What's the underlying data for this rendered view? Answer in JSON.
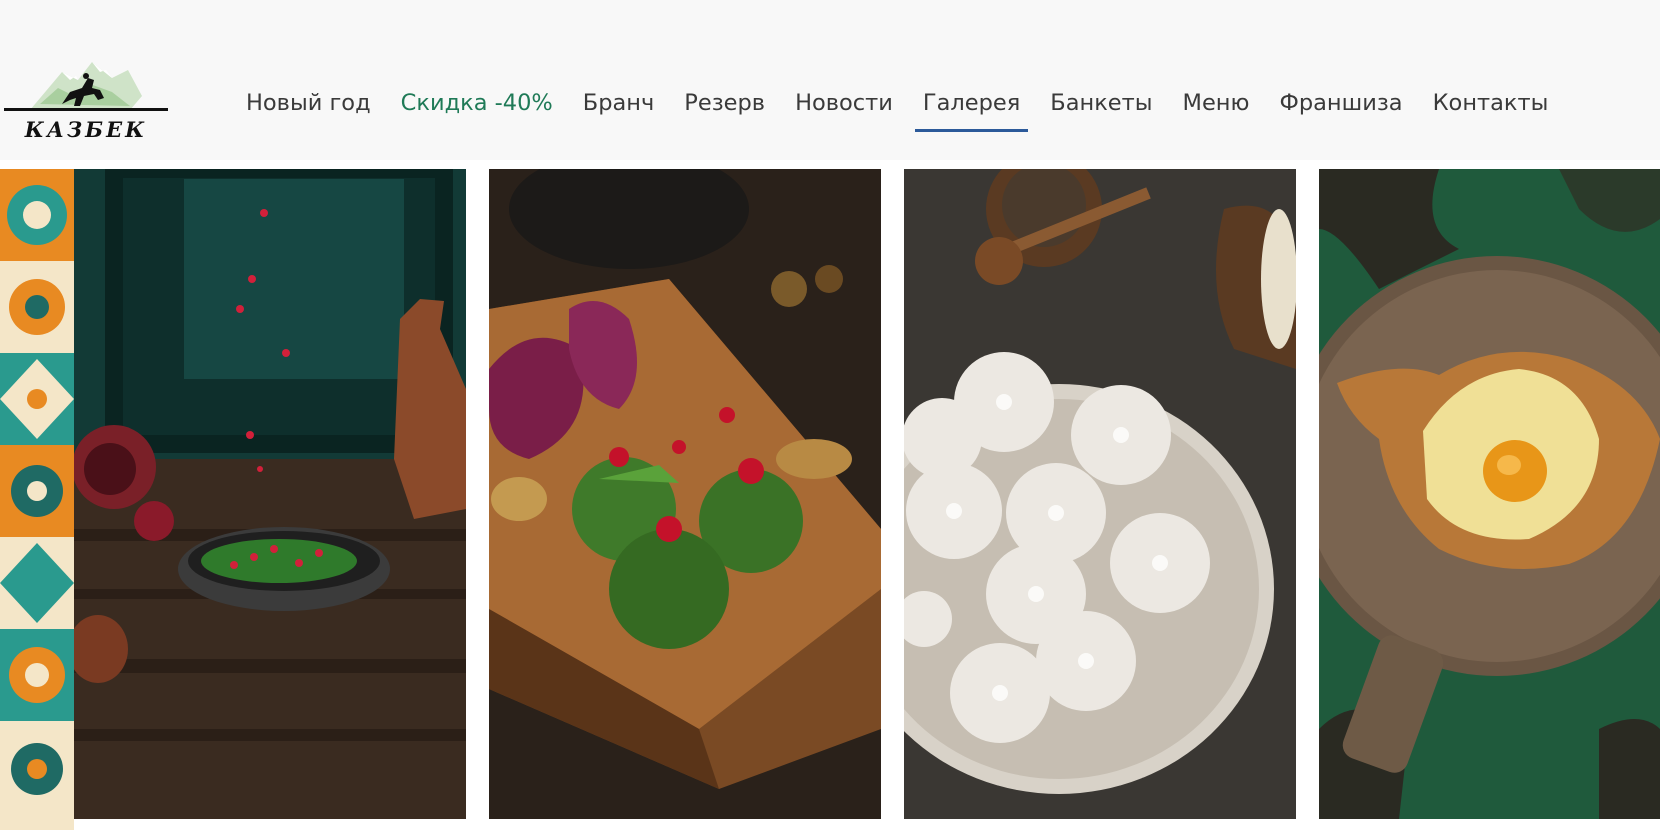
{
  "brand": {
    "logo_text": "КАЗБЕК",
    "logo_icon": "horseman-mountains-logo"
  },
  "nav": {
    "items": [
      {
        "label": "Новый год"
      },
      {
        "label": "Скидка -40%"
      },
      {
        "label": "Бранч"
      },
      {
        "label": "Резерв"
      },
      {
        "label": "Новости"
      },
      {
        "label": "Галерея"
      },
      {
        "label": "Банкеты"
      },
      {
        "label": "Меню"
      },
      {
        "label": "Франшиза"
      },
      {
        "label": "Контакты"
      }
    ],
    "active": "Галерея",
    "promo": "Скидка -40%"
  },
  "gallery": {
    "photos": [
      {
        "subject": "greens-salad-pomegranate"
      },
      {
        "subject": "spinach-pkhali-balls"
      },
      {
        "subject": "khinkali-dumplings"
      },
      {
        "subject": "adjarian-khachapuri"
      }
    ],
    "ornament": "georgian-tile-pattern"
  },
  "colors": {
    "accent": "#2c5a9a",
    "promo": "#1f7a57",
    "text": "#3a3a3a",
    "header_bg": "#f8f8f8"
  }
}
